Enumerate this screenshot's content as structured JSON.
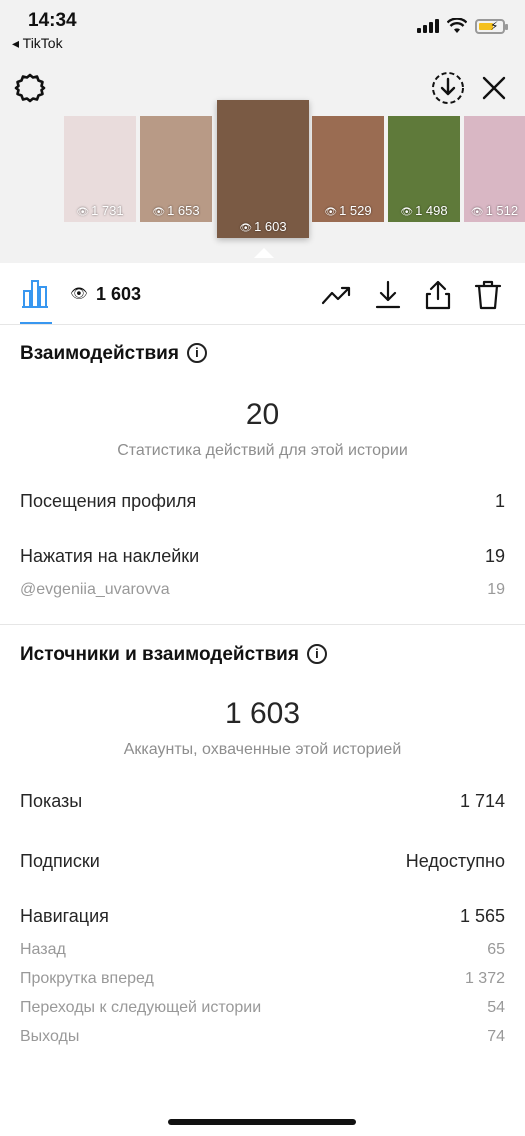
{
  "status_bar": {
    "time": "14:34",
    "back_app": "◂ TikTok"
  },
  "stories": [
    {
      "views": "1 731",
      "bg": "#e9dcdc"
    },
    {
      "views": "1 653",
      "bg": "#b89a86"
    },
    {
      "views": "1 603",
      "bg": "#7a5a44",
      "active": true
    },
    {
      "views": "1 529",
      "bg": "#9a6c52"
    },
    {
      "views": "1 498",
      "bg": "#5f7a3a"
    },
    {
      "views": "1 512",
      "bg": "#d9b7c4"
    }
  ],
  "toolbar": {
    "eye_glyph": "👁",
    "views_total": "1 603"
  },
  "interactions": {
    "title": "Взаимодействия",
    "info": "i",
    "total": "20",
    "caption": "Статистика действий для этой истории",
    "profile_visits_label": "Посещения профиля",
    "profile_visits_value": "1",
    "sticker_taps_label": "Нажатия на наклейки",
    "sticker_taps_value": "19",
    "mention_label": "@evgeniia_uvarovva",
    "mention_value": "19"
  },
  "discovery": {
    "title": "Источники и взаимодействия",
    "info": "i",
    "total": "1 603",
    "caption": "Аккаунты, охваченные этой историей",
    "impressions_label": "Показы",
    "impressions_value": "1 714",
    "follows_label": "Подписки",
    "follows_value": "Недоступно",
    "navigation_label": "Навигация",
    "navigation_value": "1 565",
    "back_label": "Назад",
    "back_value": "65",
    "forward_label": "Прокрутка вперед",
    "forward_value": "1 372",
    "next_story_label": "Переходы к следующей истории",
    "next_story_value": "54",
    "exits_label": "Выходы",
    "exits_value": "74"
  },
  "colors": {
    "accent": "#3897f0",
    "muted": "#8e8e8e",
    "header_bg": "#f2f2f2"
  }
}
